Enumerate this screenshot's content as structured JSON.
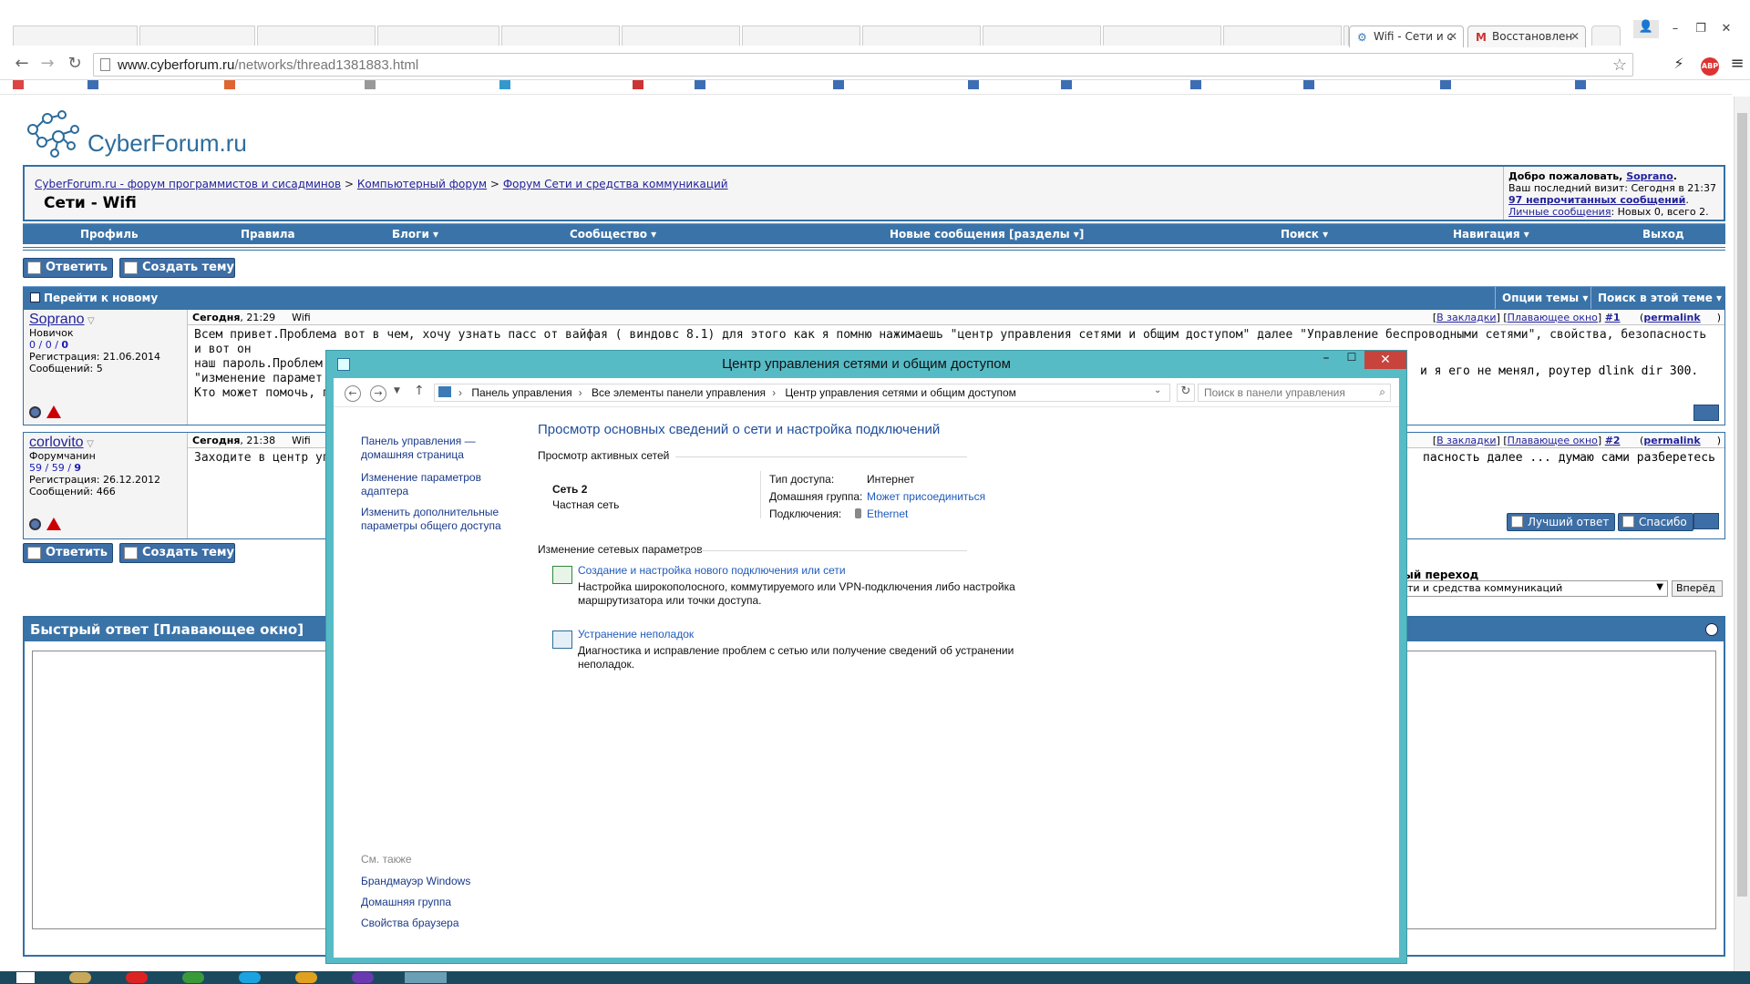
{
  "browser": {
    "tabs": [
      {
        "title": "Wifi - Сети и с",
        "active": true
      },
      {
        "title": "Восстановлен",
        "active": false
      }
    ],
    "url_host": "www.cyberforum.ru",
    "url_path": "/networks/thread1381883.html"
  },
  "forum": {
    "logo_text": "CyberForum.ru",
    "breadcrumb": [
      "CyberForum.ru - форум программистов и сисадминов",
      "Компьютерный форум",
      "Форум Сети и средства коммуникаций"
    ],
    "breadcrumb_sep": ">",
    "thread_title": "Сети - Wifi",
    "welcome": {
      "greeting": "Добро пожаловать,",
      "username": "Soprano",
      "last_visit": "Ваш последний визит: Сегодня в 21:37",
      "unread": "97 непрочитанных сообщений",
      "pm_link": "Личные сообщения",
      "pm_text": ": Новых 0, всего 2."
    },
    "nav": [
      "Профиль",
      "Правила",
      "Блоги ▾",
      "Сообщество ▾",
      "Новые сообщения [разделы ▾]",
      "Поиск ▾",
      "Навигация ▾",
      "Выход"
    ],
    "reply_button": "Ответить",
    "new_thread_button": "Создать тему",
    "go_to_new": "Перейти к новому",
    "thread_options": "Опции темы ▾",
    "search_thread": "Поиск в этой теме ▾",
    "posts": [
      {
        "username": "Soprano",
        "rank": "Новичок",
        "stats": [
          "0",
          "0",
          "0"
        ],
        "registered": "Регистрация: 21.06.2014",
        "messages": "Сообщений: 5",
        "date": "Сегодня",
        "time": ", 21:29",
        "title": "Wifi",
        "links": {
          "bookmark": "В закладки",
          "float": "Плавающее окно",
          "num": "#1",
          "perma": "permalink"
        },
        "body_lines": [
          "Всем привет.Проблема вот в чем, хочу узнать пасс от вайфая ( виндовс 8.1) для этого как я помню нажимаешь \"центр управления сетями и общим доступом\" далее \"Управление беспроводными сетями\", свойства, безопасность и вот он",
          "наш пароль.Проблем",
          "\"изменение парамет",
          "Кто может помочь, п"
        ],
        "body_right": "и я его не менял, роутер dlink dir 300."
      },
      {
        "username": "corlovito",
        "rank": "Форумчанин",
        "stats": [
          "59",
          "59",
          "9"
        ],
        "registered": "Регистрация: 26.12.2012",
        "messages": "Сообщений: 466",
        "date": "Сегодня",
        "time": ", 21:38",
        "title": "Wifi",
        "links": {
          "bookmark": "В закладки",
          "float": "Плавающее окно",
          "num": "#2",
          "perma": "permalink"
        },
        "body_left": "Заходите в центр уп",
        "body_right": "пасность далее ... думаю сами разберетесь",
        "best_answer": "Лучший ответ",
        "thanks": "Спасибо"
      }
    ],
    "quick_jump": {
      "label": "ый переход",
      "selected": "ти и средства коммуникаций",
      "go": "Вперёд"
    },
    "quick_reply_title": "Быстрый ответ [Плавающее окно]"
  },
  "dialog": {
    "title": "Центр управления сетями и общим доступом",
    "path": [
      "Панель управления",
      "Все элементы панели управления",
      "Центр управления сетями и общим доступом"
    ],
    "search_placeholder": "Поиск в панели управления",
    "left_nav": [
      [
        "Панель управления —",
        "домашняя страница"
      ],
      [
        "Изменение параметров",
        "адаптера"
      ],
      [
        "Изменить дополнительные",
        "параметры общего доступа"
      ]
    ],
    "see_also_title": "См. также",
    "see_also": [
      "Брандмауэр Windows",
      "Домашняя группа",
      "Свойства браузера"
    ],
    "main_title": "Просмотр основных сведений о сети и настройка подключений",
    "active_networks_title": "Просмотр активных сетей",
    "network_name": "Сеть 2",
    "network_type": "Частная сеть",
    "access_type_label": "Тип доступа:",
    "access_type_value": "Интернет",
    "homegroup_label": "Домашняя группа:",
    "homegroup_value": "Может присоединиться",
    "connections_label": "Подключения:",
    "connections_value": "Ethernet",
    "change_settings_title": "Изменение сетевых параметров",
    "tasks": [
      {
        "title": "Создание и настройка нового подключения или сети",
        "desc": [
          "Настройка широкополосного, коммутируемого или VPN-подключения либо настройка",
          "маршрутизатора или точки доступа."
        ]
      },
      {
        "title": "Устранение неполадок",
        "desc": [
          "Диагностика и исправление проблем с сетью или получение сведений об устранении",
          "неполадок."
        ]
      }
    ]
  },
  "colors": {
    "forum_blue": "#3a73a8",
    "dialog_frame": "#57bbc6",
    "close_red": "#c7433c",
    "link_blue": "#1f5bbd"
  }
}
